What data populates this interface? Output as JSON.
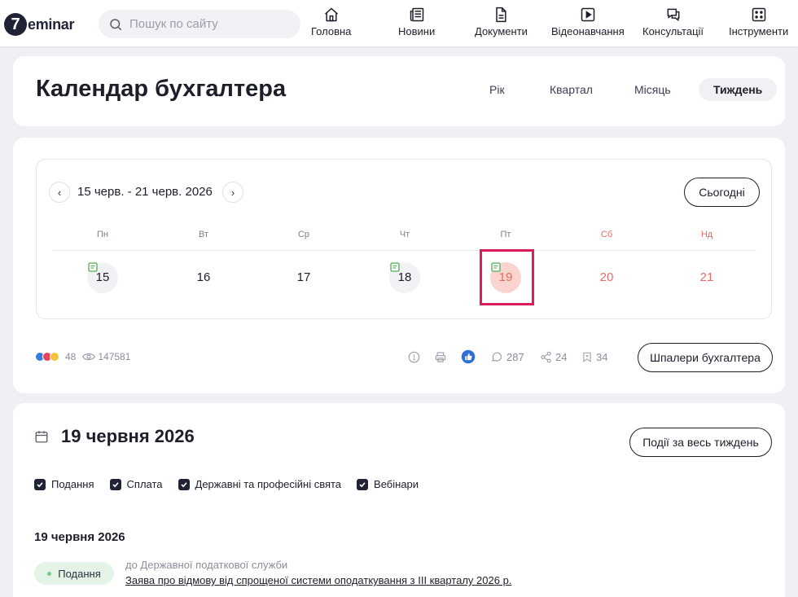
{
  "header": {
    "logo_mark": "7",
    "logo_text": "eminar",
    "search_placeholder": "Пошук по сайту",
    "nav": [
      {
        "label": "Головна",
        "icon": "home-icon"
      },
      {
        "label": "Новини",
        "icon": "news-icon"
      },
      {
        "label": "Документи",
        "icon": "document-icon"
      },
      {
        "label": "Відеонавчання",
        "icon": "video-icon"
      },
      {
        "label": "Консультації",
        "icon": "chat-icon"
      },
      {
        "label": "Інструменти",
        "icon": "tools-icon"
      }
    ]
  },
  "page": {
    "title": "Календар бухгалтера",
    "periods": [
      {
        "label": "Рік",
        "active": false
      },
      {
        "label": "Квартал",
        "active": false
      },
      {
        "label": "Місяць",
        "active": false
      },
      {
        "label": "Тиждень",
        "active": true
      }
    ]
  },
  "calendar": {
    "range": "15 черв. - 21 черв. 2026",
    "prev": "‹",
    "next": "›",
    "today_label": "Сьогодні",
    "weekdays": [
      "Пн",
      "Вт",
      "Ср",
      "Чт",
      "Пт",
      "Сб",
      "Нд"
    ],
    "days": [
      {
        "num": "15",
        "has_event": true,
        "weekend": false,
        "selected": false
      },
      {
        "num": "16",
        "has_event": false,
        "weekend": false,
        "selected": false
      },
      {
        "num": "17",
        "has_event": false,
        "weekend": false,
        "selected": false
      },
      {
        "num": "18",
        "has_event": true,
        "weekend": false,
        "selected": false
      },
      {
        "num": "19",
        "has_event": true,
        "weekend": false,
        "selected": true
      },
      {
        "num": "20",
        "has_event": false,
        "weekend": true,
        "selected": false
      },
      {
        "num": "21",
        "has_event": false,
        "weekend": true,
        "selected": false
      }
    ],
    "colors": {
      "weekend": "#e76b66",
      "selected_bg": "#fbd3cf",
      "highlight": "#d91d5c",
      "event_mark": "#4caf50"
    }
  },
  "stats": {
    "reactions_count": "48",
    "views": "147581",
    "comments": "287",
    "shares": "24",
    "saves": "34",
    "wallpaper_label": "Шпалери бухгалтера"
  },
  "day_view": {
    "date_title": "19 червня 2026",
    "week_events_label": "Події за весь тиждень",
    "filters": [
      "Подання",
      "Сплата",
      "Державні та професійні свята",
      "Вебінари"
    ],
    "section_date": "19 червня 2026",
    "events": [
      {
        "tag": "Подання",
        "source": "до Державної податкової служби",
        "title": "Заява про відмову від спрощеної системи оподаткування з ІІІ кварталу 2026 р."
      }
    ]
  }
}
